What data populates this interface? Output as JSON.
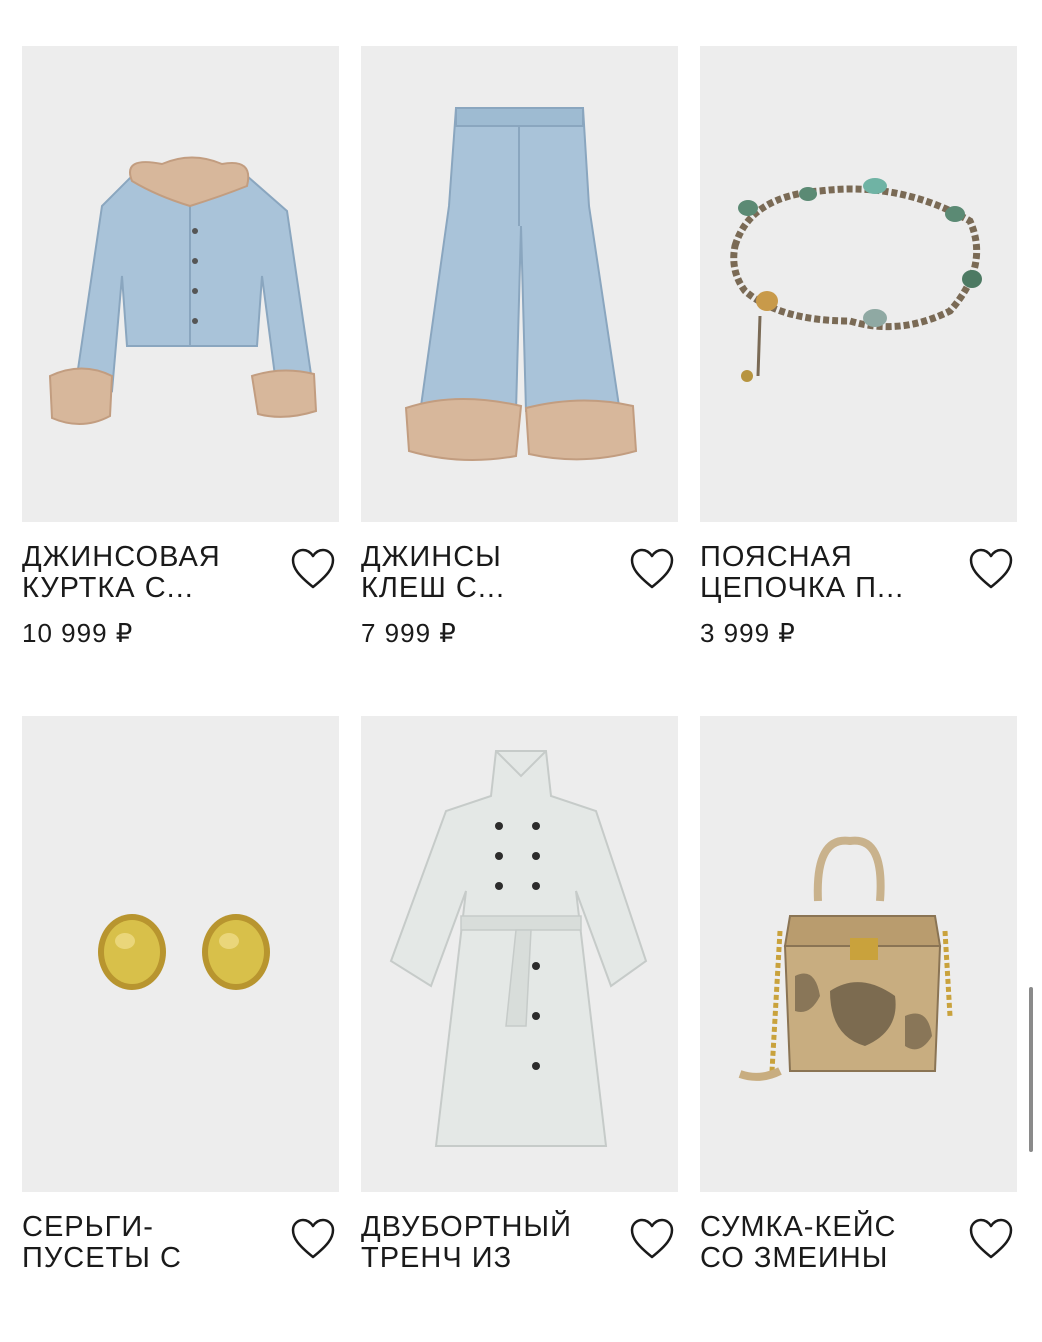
{
  "products": [
    {
      "title": "ДЖИНСОВАЯ\nКУРТКА С...",
      "price": "10 999 ₽",
      "image": "denim-jacket-image"
    },
    {
      "title": "ДЖИНСЫ\nКЛЕШ С...",
      "price": "7 999 ₽",
      "image": "flare-jeans-image"
    },
    {
      "title": "ПОЯСНАЯ\nЦЕПОЧКА П...",
      "price": "3 999 ₽",
      "image": "chain-belt-image"
    },
    {
      "title": "СЕРЬГИ-\nПУСЕТЫ С",
      "price": "",
      "image": "stud-earrings-image"
    },
    {
      "title": "ДВУБОРТНЫЙ\nТРЕНЧ ИЗ",
      "price": "",
      "image": "trench-coat-image"
    },
    {
      "title": "СУМКА-КЕЙС\nСО ЗМЕИНЫ",
      "price": "",
      "image": "snake-case-bag-image"
    }
  ],
  "icons": {
    "favorite": "heart-outline-icon"
  },
  "colors": {
    "card_background": "#ededed",
    "text": "#1a1a1a"
  }
}
